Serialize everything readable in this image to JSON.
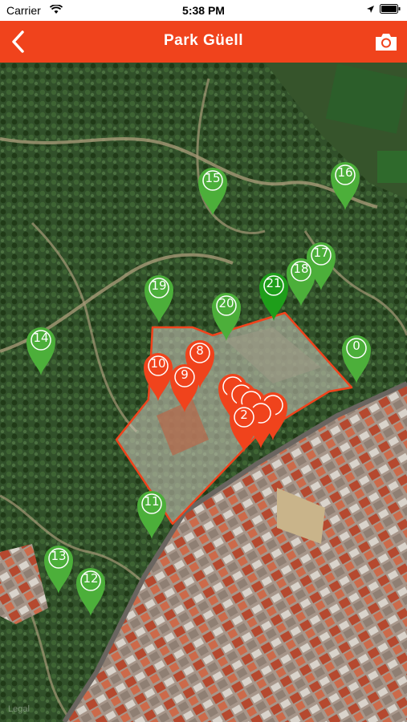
{
  "status": {
    "carrier": "Carrier",
    "time": "5:38 PM"
  },
  "header": {
    "title": "Park Güell"
  },
  "colors": {
    "accent": "#f0431c",
    "pin_green": "#4caf3a",
    "pin_green_selected": "#1e9e1a",
    "pin_red": "#f0431c"
  },
  "icons": {
    "back": "chevron-left-icon",
    "camera": "camera-icon",
    "wifi": "wifi-icon",
    "location": "location-arrow-icon",
    "battery": "battery-icon"
  },
  "map": {
    "watermark": "Legal",
    "green_pins": [
      {
        "label": "15"
      },
      {
        "label": "16"
      },
      {
        "label": "17"
      },
      {
        "label": "18"
      },
      {
        "label": "21"
      },
      {
        "label": "19"
      },
      {
        "label": "20"
      },
      {
        "label": "14"
      },
      {
        "label": "0"
      },
      {
        "label": "11"
      },
      {
        "label": "13"
      },
      {
        "label": "12"
      }
    ],
    "red_pins": [
      {
        "label": "8"
      },
      {
        "label": "10"
      },
      {
        "label": "9"
      },
      {
        "label": ""
      },
      {
        "label": ""
      },
      {
        "label": ""
      },
      {
        "label": ""
      },
      {
        "label": ""
      },
      {
        "label": "2"
      }
    ]
  }
}
